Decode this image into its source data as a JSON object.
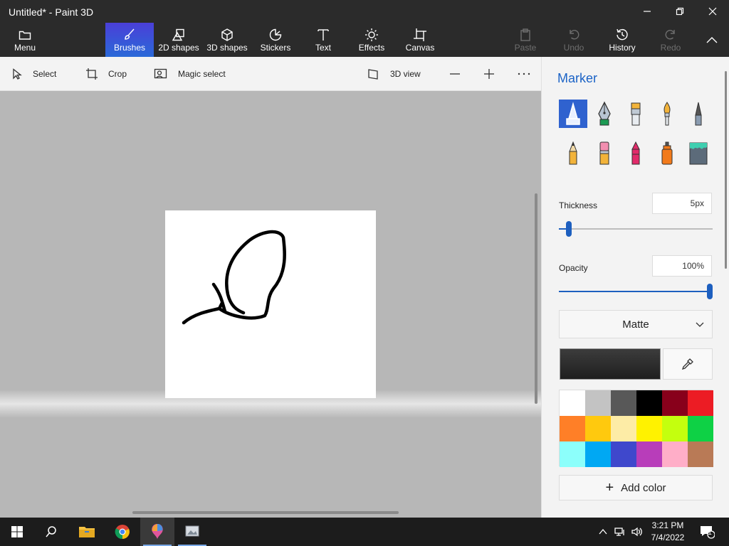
{
  "window": {
    "title": "Untitled* - Paint 3D"
  },
  "ribbon": {
    "menu_label": "Menu",
    "tabs": [
      {
        "id": "brushes",
        "label": "Brushes",
        "icon": "brush-icon",
        "active": true
      },
      {
        "id": "shapes2d",
        "label": "2D shapes",
        "icon": "2d-shapes-icon"
      },
      {
        "id": "shapes3d",
        "label": "3D shapes",
        "icon": "3d-cube-icon"
      },
      {
        "id": "stickers",
        "label": "Stickers",
        "icon": "sticker-icon"
      },
      {
        "id": "text",
        "label": "Text",
        "icon": "text-icon"
      },
      {
        "id": "effects",
        "label": "Effects",
        "icon": "sun-icon"
      },
      {
        "id": "canvas",
        "label": "Canvas",
        "icon": "canvas-icon"
      }
    ],
    "actions": [
      {
        "id": "paste",
        "label": "Paste",
        "enabled": false
      },
      {
        "id": "undo",
        "label": "Undo",
        "enabled": false
      },
      {
        "id": "history",
        "label": "History",
        "enabled": true
      },
      {
        "id": "redo",
        "label": "Redo",
        "enabled": false
      }
    ]
  },
  "toolbar": {
    "select_label": "Select",
    "crop_label": "Crop",
    "magic_select_label": "Magic select",
    "view3d_label": "3D view"
  },
  "panel": {
    "title": "Marker",
    "brushes": [
      "marker",
      "calligraphy-pen",
      "oil-brush",
      "watercolor",
      "pixel-pen",
      "pencil",
      "eraser",
      "crayon",
      "spray-can",
      "fill"
    ],
    "selected_brush": "marker",
    "thickness": {
      "label": "Thickness",
      "value": "5px",
      "fraction": 0.05
    },
    "opacity": {
      "label": "Opacity",
      "value": "100%",
      "fraction": 1.0
    },
    "finish": {
      "selected": "Matte"
    },
    "current_color": "#1f1f1f",
    "palette": [
      "#ffffff",
      "#c3c3c3",
      "#585858",
      "#000000",
      "#88001b",
      "#ec1c24",
      "#ff7f27",
      "#ffc90e",
      "#fdeca6",
      "#fff200",
      "#c4ff0e",
      "#0ed145",
      "#8cfffb",
      "#00a8f3",
      "#3f48cc",
      "#b83dba",
      "#ffaec8",
      "#b97a56"
    ],
    "add_color_label": "Add color"
  },
  "taskbar": {
    "time": "3:21 PM",
    "date": "7/4/2022",
    "notification_count": "1"
  }
}
